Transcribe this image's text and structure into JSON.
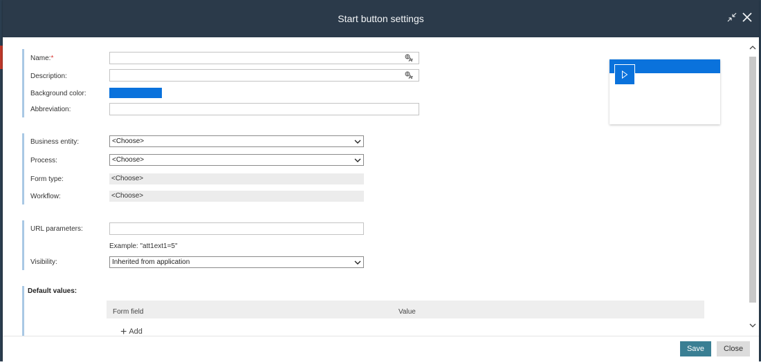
{
  "dialog": {
    "title": "Start button settings",
    "minimize_icon": "collapse-arrows-icon",
    "close_icon": "close-icon"
  },
  "general": {
    "name_label": "Name:",
    "required_mark": "*",
    "name_value": "",
    "description_label": "Description:",
    "description_value": "",
    "background_color_label": "Background color:",
    "background_color": "#0A72DC",
    "abbreviation_label": "Abbreviation:",
    "abbreviation_value": ""
  },
  "binding": {
    "business_entity_label": "Business entity:",
    "business_entity_value": "<Choose>",
    "process_label": "Process:",
    "process_value": "<Choose>",
    "form_type_label": "Form type:",
    "form_type_value": "<Choose>",
    "workflow_label": "Workflow:",
    "workflow_value": "<Choose>"
  },
  "url": {
    "url_parameters_label": "URL parameters:",
    "url_parameters_value": "",
    "example_text": "Example: \"att1ext1=5\"",
    "visibility_label": "Visibility:",
    "visibility_value": "Inherited from application"
  },
  "defaults": {
    "title": "Default values:",
    "col_form_field": "Form field",
    "col_value": "Value",
    "add_label": "Add"
  },
  "footer": {
    "save_label": "Save",
    "close_label": "Close"
  },
  "colors": {
    "titlebar": "#2B3A4A",
    "accent_blue": "#0A72DC",
    "save_button": "#3A7F93",
    "section_bar": "#A9C8E4"
  }
}
